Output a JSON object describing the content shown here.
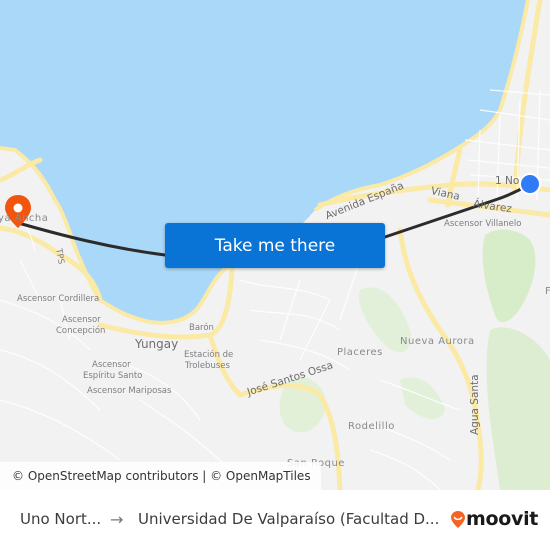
{
  "map": {
    "labels": {
      "playa_ancha": "ya Ancha",
      "tps": "TPS",
      "ascensor_cordillera": "Ascensor Cordillera",
      "ascensor_concepcion_1": "Ascensor",
      "ascensor_concepcion_2": "Concepción",
      "yungay": "Yungay",
      "baron": "Barón",
      "estacion_1": "Estación de",
      "estacion_2": "Trolebuses",
      "espiritu_1": "Ascensor",
      "espiritu_2": "Espíritu Santo",
      "mariposas": "Ascensor Mariposas",
      "jose_santos_ossa": "José Santos Ossa",
      "placeres": "Placeres",
      "nueva_aurora": "Nueva Aurora",
      "rodelillo": "Rodelillo",
      "san_roque": "San Roque",
      "agua_santa": "Agua Santa",
      "avenida_espana": "Avenida España",
      "viana": "Viana",
      "alvarez": "Álvarez",
      "ascensor_villanelo": "Ascensor Villanelo",
      "uno_norte": "1 No",
      "f_partial": "F"
    },
    "colors": {
      "water": "#aad8f8",
      "land": "#f2f2f3",
      "road_major": "#fbe9a6",
      "park": "#d4ebc3",
      "route": "#2b2b2b",
      "origin_marker": "#2f7cf6",
      "destination_marker": "#f2560c"
    },
    "origin_marker": "current-location-dot",
    "destination_marker": "destination-pin"
  },
  "cta": {
    "label": "Take me there",
    "color": "#0a74d6"
  },
  "attribution": {
    "text": "© OpenStreetMap contributors | © OpenMapTiles"
  },
  "footer": {
    "from": "Uno Nort...",
    "arrow": "→",
    "to": "Universidad De Valparaíso (Facultad D...",
    "brand": "moovit",
    "brand_color": "#f26522"
  }
}
